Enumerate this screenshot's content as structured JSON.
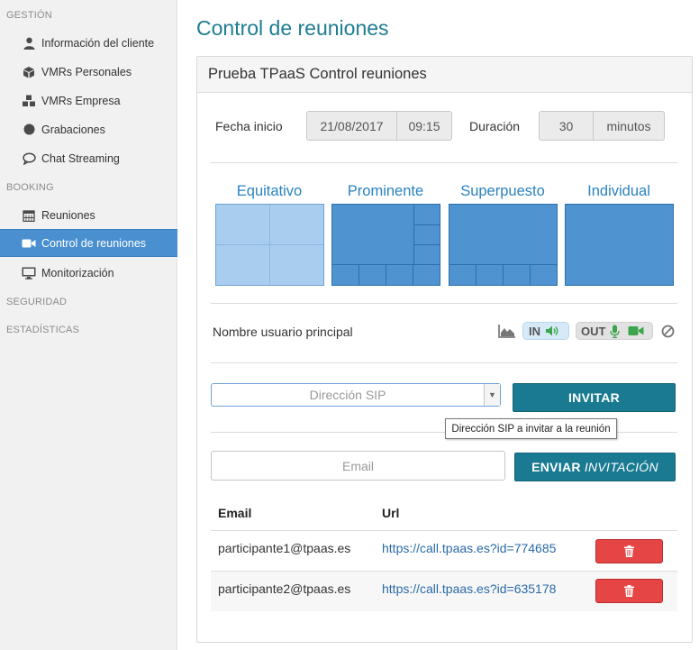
{
  "sidebar": {
    "sections": [
      {
        "title": "GESTIÓN"
      },
      {
        "title": "BOOKING"
      },
      {
        "title": "SEGURIDAD"
      },
      {
        "title": "ESTADÍSTICAS"
      }
    ],
    "items": [
      {
        "label": "Información del cliente",
        "icon": "user-icon"
      },
      {
        "label": "VMRs Personales",
        "icon": "cube-icon"
      },
      {
        "label": "VMRs Empresa",
        "icon": "cubes-icon"
      },
      {
        "label": "Grabaciones",
        "icon": "circle-icon"
      },
      {
        "label": "Chat Streaming",
        "icon": "chat-icon"
      },
      {
        "label": "Reuniones",
        "icon": "calendar-icon"
      },
      {
        "label": "Control de reuniones",
        "icon": "video-camera-icon",
        "active": true
      },
      {
        "label": "Monitorización",
        "icon": "monitor-icon"
      }
    ]
  },
  "page": {
    "title": "Control de reuniones"
  },
  "panel": {
    "title": "Prueba TPaaS Control reuniones",
    "fecha_label": "Fecha inicio",
    "fecha_value": "21/08/2017",
    "hora_value": "09:15",
    "duracion_label": "Duración",
    "duracion_value": "30",
    "duracion_unit": "minutos",
    "layouts": [
      {
        "label": "Equitativo"
      },
      {
        "label": "Prominente"
      },
      {
        "label": "Superpuesto"
      },
      {
        "label": "Individual"
      }
    ],
    "main_user_label": "Nombre usuario principal",
    "audio_in_label": "IN",
    "audio_out_label": "OUT",
    "sip_placeholder": "Dirección SIP",
    "invite_button": "INVITAR",
    "tooltip": "Dirección SIP a invitar a la reunión",
    "email_placeholder": "Email",
    "send_button_bold": "ENVIAR",
    "send_button_italic": "INVITACIÓN",
    "table": {
      "headers": {
        "email": "Email",
        "url": "Url"
      },
      "rows": [
        {
          "email": "participante1@tpaas.es",
          "url": "https://call.tpaas.es?id=774685"
        },
        {
          "email": "participante2@tpaas.es",
          "url": "https://call.tpaas.es?id=635178"
        }
      ]
    }
  },
  "colors": {
    "accent": "#1a7a91",
    "active_nav": "#4a90d0",
    "danger": "#e64545",
    "link": "#2a6aa8"
  }
}
